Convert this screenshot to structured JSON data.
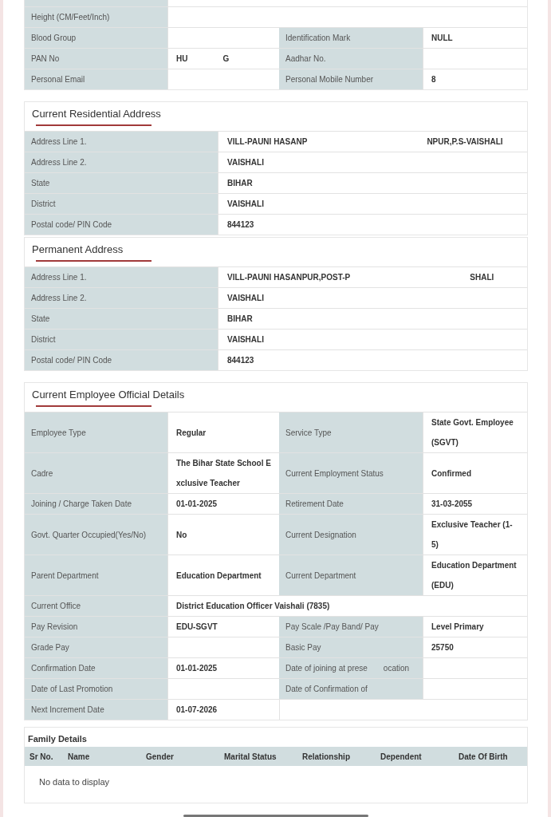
{
  "personal": {
    "rows": [
      {
        "pairs": [
          {
            "label": "Height (CM/Feet/Inch)"
          }
        ]
      },
      {
        "pairs": [
          {
            "label": "Blood Group"
          },
          {
            "label": "Identification Mark",
            "value": "NULL"
          }
        ]
      },
      {
        "pairs": [
          {
            "label": "PAN No",
            "value": "HU",
            "value_tail": "G"
          },
          {
            "label": "Aadhar No."
          }
        ]
      },
      {
        "pairs": [
          {
            "label": "Personal Email"
          },
          {
            "label": "Personal Mobile Number",
            "value": "8"
          }
        ]
      }
    ]
  },
  "addresses": [
    {
      "title": "Current Residential Address",
      "rows": [
        {
          "label": "Address Line 1.",
          "value": "VILL-PAUNI HASANP",
          "value_tail": "NPUR,P.S-VAISHALI"
        },
        {
          "label": "Address Line 2.",
          "value": "VAISHALI"
        },
        {
          "label": "State",
          "value": "BIHAR"
        },
        {
          "label": "District",
          "value": "VAISHALI"
        },
        {
          "label": "Postal code/ PIN Code",
          "value": "844123"
        }
      ]
    },
    {
      "title": "Permanent Address",
      "rows": [
        {
          "label": "Address Line 1.",
          "value": "VILL-PAUNI HASANPUR,POST-P",
          "value_tail": "SHALI"
        },
        {
          "label": "Address Line 2.",
          "value": "VAISHALI"
        },
        {
          "label": "State",
          "value": "BIHAR"
        },
        {
          "label": "District",
          "value": "VAISHALI"
        },
        {
          "label": "Postal code/ PIN Code",
          "value": "844123"
        }
      ]
    }
  ],
  "official": {
    "title": "Current Employee Official Details",
    "rows": [
      {
        "pairs": [
          {
            "label": "Employee Type",
            "value": "Regular"
          },
          {
            "label": "Service Type",
            "value": "State Govt. Employee(SGVT)"
          }
        ]
      },
      {
        "pairs": [
          {
            "label": "Cadre",
            "value": "The Bihar State School Exclusive Teacher"
          },
          {
            "label": "Current Employment Status",
            "value": "Confirmed"
          }
        ]
      },
      {
        "pairs": [
          {
            "label": "Joining / Charge Taken Date",
            "value": "01-01-2025"
          },
          {
            "label": "Retirement Date",
            "value": "31-03-2055"
          }
        ]
      },
      {
        "pairs": [
          {
            "label": "Govt. Quarter Occupied(Yes/No)",
            "value": "No"
          },
          {
            "label": "Current Designation",
            "value": "Exclusive Teacher (1-5)"
          }
        ]
      },
      {
        "pairs": [
          {
            "label": "Parent Department",
            "value": "Education Department"
          },
          {
            "label": "Current Department",
            "value": "Education Department (EDU)"
          }
        ]
      },
      {
        "pairs": [
          {
            "label": "Current Office",
            "value": "District Education Officer Vaishali (7835)"
          }
        ],
        "kind": "full"
      },
      {
        "pairs": [
          {
            "label": "Pay Revision",
            "value": "EDU-SGVT"
          },
          {
            "label": "Pay Scale /Pay Band/ Pay",
            "value": "Level Primary"
          }
        ]
      },
      {
        "pairs": [
          {
            "label": "Grade Pay"
          },
          {
            "label": "Basic Pay",
            "value": "25750"
          }
        ]
      },
      {
        "pairs": [
          {
            "label": "Confirmation Date",
            "value": "01-01-2025"
          },
          {
            "label": "Date of joining at prese",
            "label_tail": "ocation"
          }
        ]
      },
      {
        "pairs": [
          {
            "label": "Date of Last Promotion"
          },
          {
            "label": "Date of Confirmation of"
          }
        ]
      },
      {
        "pairs": [
          {
            "label": "Next Increment Date",
            "value": "01-07-2026"
          }
        ],
        "kind": "half"
      }
    ]
  },
  "family": {
    "title": "Family Details",
    "columns": [
      "Sr No.",
      "Name",
      "Gender",
      "Marital Status",
      "Relationship",
      "Dependent",
      "Date Of Birth"
    ],
    "empty_text": "No data to display"
  }
}
